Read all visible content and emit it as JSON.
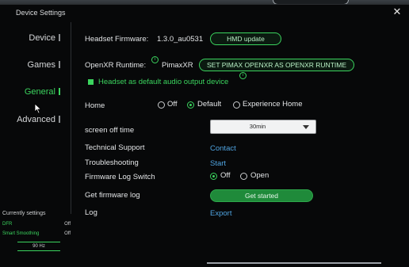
{
  "window": {
    "title": "Device Settings",
    "close_glyph": "✕"
  },
  "sidebar": {
    "items": [
      {
        "label": "Device",
        "active": false
      },
      {
        "label": "Games",
        "active": false
      },
      {
        "label": "General",
        "active": true
      },
      {
        "label": "Advanced",
        "active": false
      }
    ]
  },
  "current_settings": {
    "heading": "Currently settings",
    "rows": [
      {
        "label": "DFR",
        "value": "Off"
      },
      {
        "label": "Smart Smoothing",
        "value": "Off"
      }
    ],
    "frequency": "90 Hz"
  },
  "general": {
    "firmware": {
      "label": "Headset Firmware:",
      "value": "1.3.0_au0531",
      "button": "HMD update"
    },
    "openxr": {
      "label": "OpenXR Runtime:",
      "value": "PimaxXR",
      "button": "SET PIMAX OPENXR AS OPENXR RUNTIME"
    },
    "audio_checkbox": {
      "label": "Headset as default audio output device",
      "checked": true
    },
    "home": {
      "label": "Home",
      "options": [
        "Off",
        "Default",
        "Experience Home"
      ],
      "selected": "Default"
    },
    "screen_off": {
      "label": "screen off time",
      "value": "30min"
    },
    "technical_support": {
      "label": "Technical Support",
      "link": "Contact"
    },
    "troubleshooting": {
      "label": "Troubleshooting",
      "link": "Start"
    },
    "firmware_log_switch": {
      "label": "Firmware Log Switch",
      "options": [
        "Off",
        "Open"
      ],
      "selected": "Off"
    },
    "get_firmware_log": {
      "label": "Get firmware log",
      "button": "Get started"
    },
    "log": {
      "label": "Log",
      "link": "Export"
    },
    "info_glyph": "i"
  },
  "colors": {
    "accent": "#3bd45e",
    "link": "#4fa3e0",
    "background": "#070809"
  }
}
